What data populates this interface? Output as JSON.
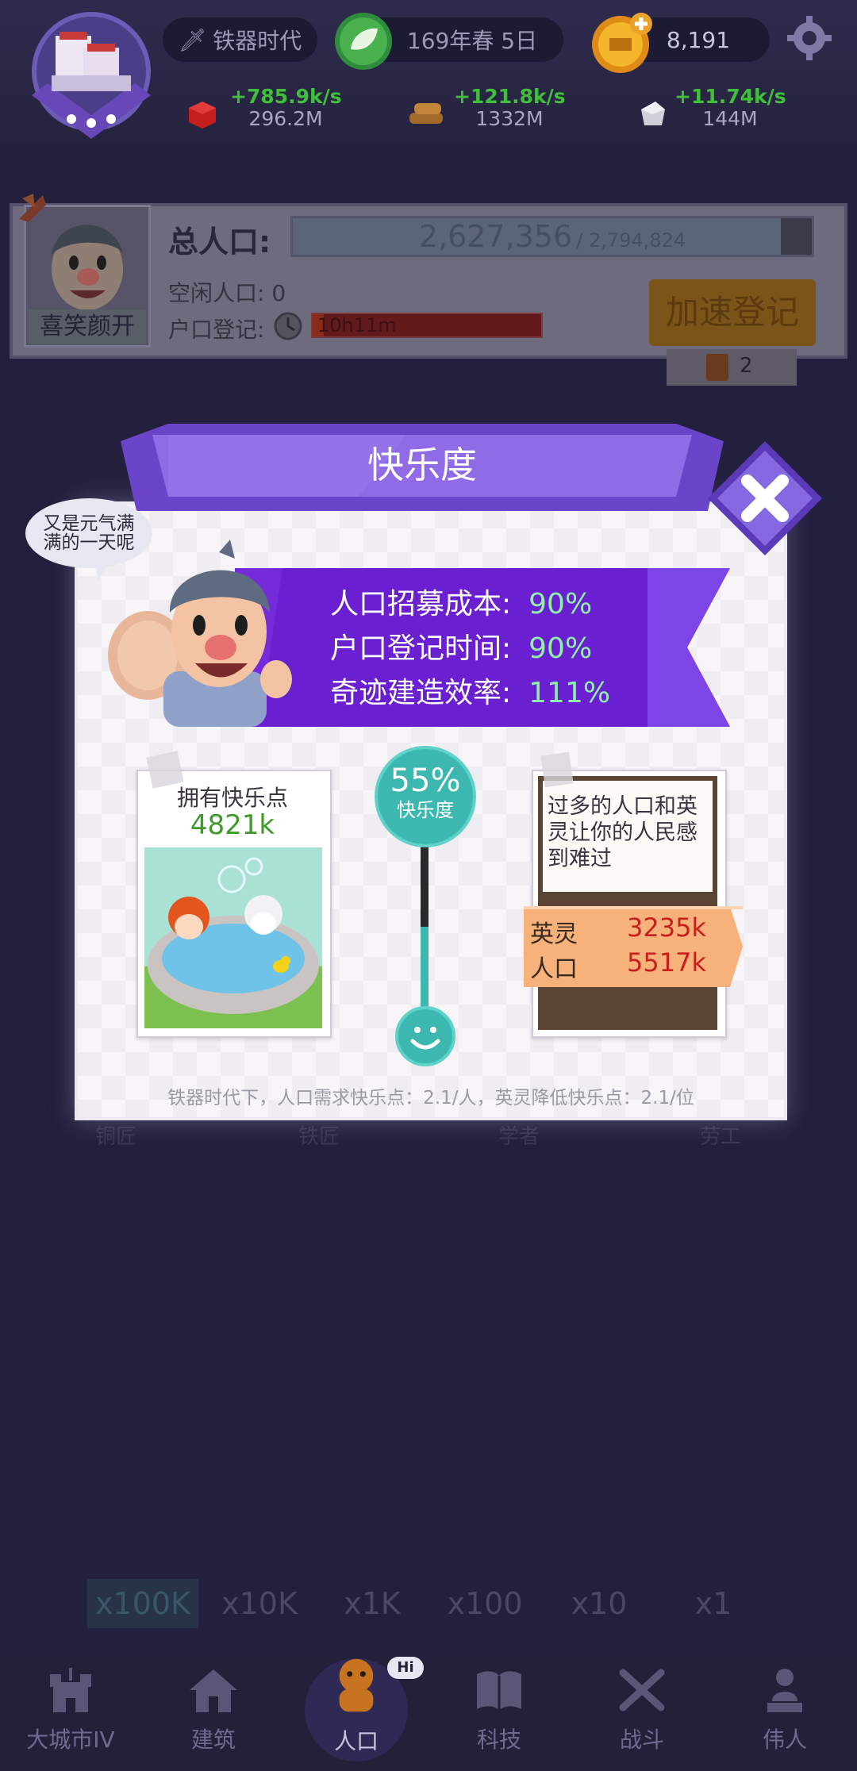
{
  "topbar": {
    "era": "铁器时代",
    "date": "169年春 5日",
    "coins": "8,191",
    "resources": [
      {
        "icon": "red-cube-icon",
        "rate": "+785.9k/s",
        "amount": "296.2M"
      },
      {
        "icon": "wood-logs-icon",
        "rate": "+121.8k/s",
        "amount": "1332M"
      },
      {
        "icon": "stone-icon",
        "rate": "+11.74k/s",
        "amount": "144M"
      }
    ]
  },
  "population": {
    "label": "总人口:",
    "current": "2,627,356",
    "max": "/ 2,794,824",
    "fill_fraction": 0.94,
    "idle": "空闲人口: 0",
    "register_label": "户口登记:",
    "register_timer": "10h11m",
    "speedup_button": "加速登记",
    "book_count": "2",
    "mood_label": "喜笑颜开"
  },
  "modal": {
    "title": "快乐度",
    "speech": "又是元气满满的一天呢",
    "stats": [
      {
        "label": "人口招募成本:",
        "value": "90%"
      },
      {
        "label": "户口登记时间:",
        "value": "90%"
      },
      {
        "label": "奇迹建造效率:",
        "value": "111%"
      }
    ],
    "points_label": "拥有快乐点",
    "points_value": "4821k",
    "happiness_percent": "55%",
    "happiness_fraction": 0.55,
    "happiness_label": "快乐度",
    "warning_text": "过多的人口和英灵让你的人民感到难过",
    "heroes_label": "英灵",
    "heroes_value": "3235k",
    "people_label": "人口",
    "people_value": "5517k",
    "footer": "铁器时代下，人口需求快乐点：2.1/人，英灵降低快乐点：2.1/位"
  },
  "background_workers": [
    "铜匠",
    "铁匠",
    "学者",
    "劳工"
  ],
  "multipliers": [
    "x100K",
    "x10K",
    "x1K",
    "x100",
    "x10",
    "x1"
  ],
  "nav": [
    {
      "label": "大城市IV"
    },
    {
      "label": "建筑"
    },
    {
      "label": "人口",
      "badge": "Hi"
    },
    {
      "label": "科技"
    },
    {
      "label": "战斗"
    },
    {
      "label": "伟人"
    }
  ],
  "colors": {
    "accent_purple": "#6a3fd0",
    "teal": "#3db8b0",
    "orange": "#f08a1c",
    "green": "#3fbf3a",
    "red": "#c81e1e"
  }
}
